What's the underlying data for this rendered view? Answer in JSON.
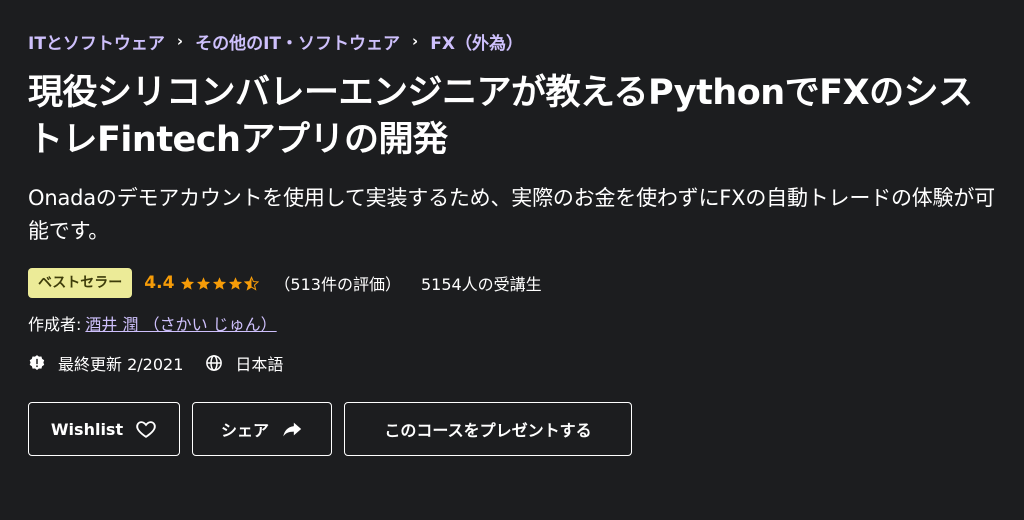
{
  "breadcrumb": {
    "items": [
      "ITとソフトウェア",
      "その他のIT・ソフトウェア",
      "FX（外為）"
    ],
    "separator": "›"
  },
  "course": {
    "title": "現役シリコンバレーエンジニアが教えるPythonでFXのシストレFintechアプリの開発",
    "subtitle": "Onadaのデモアカウントを使用して実装するため、実際のお金を使わずにFXの自動トレードの体験が可能です。",
    "badge": "ベストセラー",
    "rating": "4.4",
    "rating_value": 4.4,
    "rating_count": "（513件の評価）",
    "students": "5154人の受講生",
    "author_label": "作成者:",
    "author_name": "酒井 潤 （さかい じゅん）",
    "last_updated": "最終更新 2/2021",
    "language": "日本語"
  },
  "buttons": {
    "wishlist": "Wishlist",
    "share": "シェア",
    "gift": "このコースをプレゼントする"
  },
  "colors": {
    "background": "#1c1d1f",
    "link": "#cec0fc",
    "badge_bg": "#eceb98",
    "rating": "#f69c08"
  }
}
